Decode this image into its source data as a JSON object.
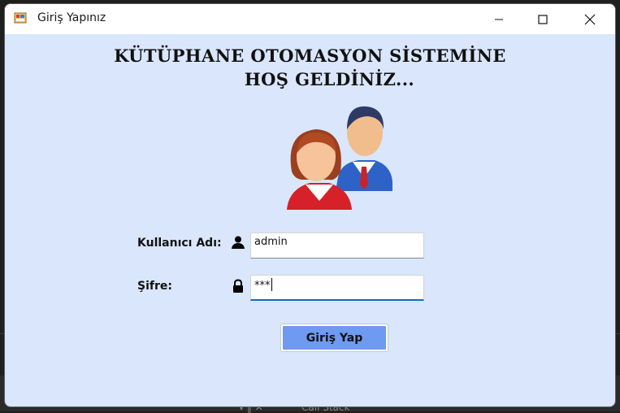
{
  "window": {
    "title": "Giriş Yapınız"
  },
  "welcome": {
    "line1": "KÜTÜPHANE OTOMASYON SİSTEMİNE",
    "line2": "HOŞ GELDİNİZ..."
  },
  "form": {
    "username_label": "Kullanıcı Adı:",
    "username_value": "admin",
    "password_label": "Şifre:",
    "password_value": "***",
    "login_button": "Giriş Yap"
  },
  "background": {
    "call_stack_label": "Call Stack"
  },
  "icons": {
    "app": "app-window-icon",
    "users": "users-icon",
    "user": "user-icon",
    "lock": "lock-icon"
  },
  "colors": {
    "window_bg": "#d9e6fb",
    "button_bg": "#6f9af1",
    "focus_underline": "#0f6cbd"
  }
}
